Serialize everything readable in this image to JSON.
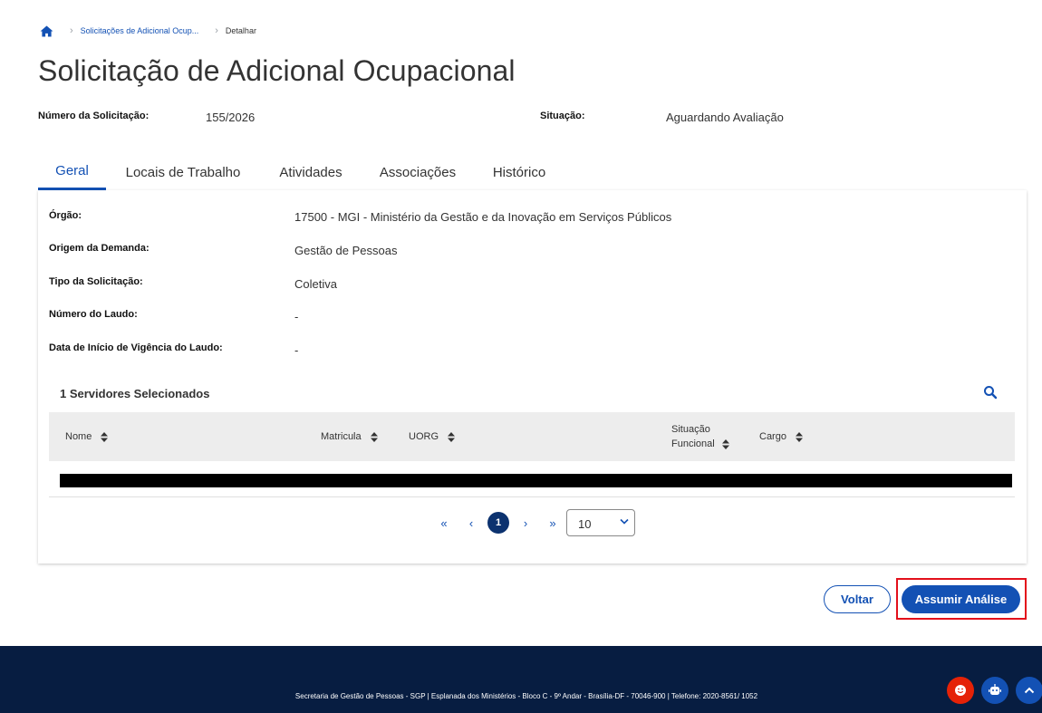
{
  "breadcrumb": {
    "items": [
      "Solicitações de Adicional Ocup...",
      "Detalhar"
    ]
  },
  "page": {
    "title": "Solicitação de Adicional Ocupacional"
  },
  "meta": {
    "numero_label": "Número da Solicitação:",
    "numero_value": "155/2026",
    "situacao_label": "Situação:",
    "situacao_value": "Aguardando Avaliação"
  },
  "tabs": [
    {
      "label": "Geral",
      "active": true
    },
    {
      "label": "Locais de Trabalho",
      "active": false
    },
    {
      "label": "Atividades",
      "active": false
    },
    {
      "label": "Associações",
      "active": false
    },
    {
      "label": "Histórico",
      "active": false
    }
  ],
  "fields": [
    {
      "label": "Órgão:",
      "value": "17500 - MGI - Ministério da Gestão e da Inovação em Serviços Públicos"
    },
    {
      "label": "Origem da Demanda:",
      "value": "Gestão de Pessoas"
    },
    {
      "label": "Tipo da Solicitação:",
      "value": "Coletiva"
    },
    {
      "label": "Número do Laudo:",
      "value": "-"
    },
    {
      "label": "Data de Início de Vigência do Laudo:",
      "value": "-"
    }
  ],
  "table": {
    "title": "1 Servidores Selecionados",
    "columns": [
      "Nome",
      "Matricula",
      "UORG",
      "Situação Funcional",
      "Cargo"
    ],
    "situacao_line1": "Situação",
    "situacao_line2": "Funcional"
  },
  "pagination": {
    "current_page": "1",
    "page_size": "10",
    "first": "«",
    "prev": "‹",
    "next": "›",
    "last": "»"
  },
  "actions": {
    "voltar": "Voltar",
    "assumir": "Assumir Análise"
  },
  "footer": {
    "text": "Secretaria de Gestão de Pessoas - SGP | Esplanada dos Ministérios - Bloco C - 9º Andar - Brasília-DF - 70046-900 | Telefone: 2020-8561/ 1052"
  },
  "colors": {
    "primary": "#1351b4",
    "dark_blue": "#0c326f",
    "footer_bg": "#071d41",
    "highlight": "#e3101b",
    "help_red": "#e52207"
  }
}
